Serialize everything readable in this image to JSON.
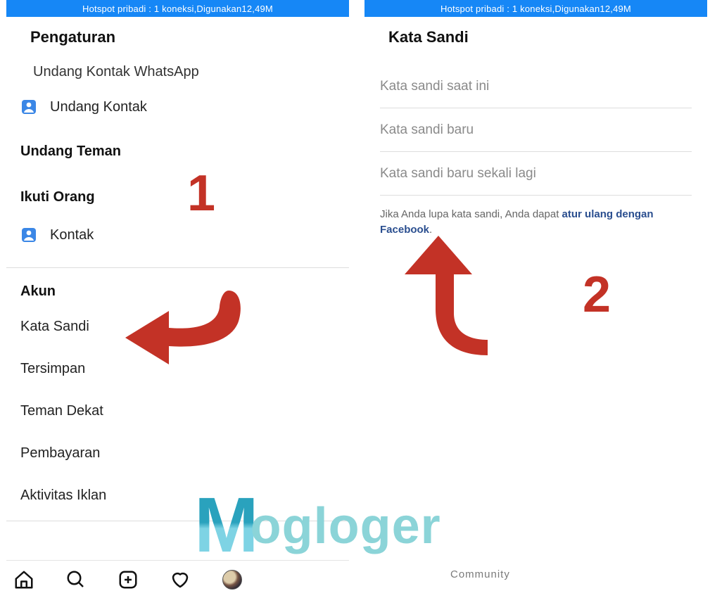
{
  "status_text": "Hotspot pribadi : 1 koneksi,Digunakan12,49M",
  "left": {
    "title": "Pengaturan",
    "cutoff_row": "Undang Kontak WhatsApp",
    "rows1": [
      {
        "label": "Undang Kontak",
        "icon": "contact"
      }
    ],
    "section1": "Undang Teman",
    "section2": "Ikuti Orang",
    "rows2": [
      {
        "label": "Kontak",
        "icon": "contact"
      }
    ],
    "section3": "Akun",
    "rows3_plain": [
      "Kata Sandi",
      "Tersimpan",
      "Teman Dekat",
      "Pembayaran",
      "Aktivitas Iklan"
    ],
    "tabbar_icons": [
      "home",
      "search",
      "add",
      "heart",
      "profile"
    ]
  },
  "right": {
    "title": "Kata Sandi",
    "fields": [
      "Kata sandi saat ini",
      "Kata sandi baru",
      "Kata sandi baru sekali lagi"
    ],
    "helper_pre": "Jika Anda lupa kata sandi, Anda dapat ",
    "helper_link": "atur ulang dengan Facebook",
    "helper_post": "."
  },
  "annotations": {
    "num1": "1",
    "num2": "2"
  },
  "watermark": {
    "m": "M",
    "rest": "ogloger",
    "sub": "Community"
  }
}
